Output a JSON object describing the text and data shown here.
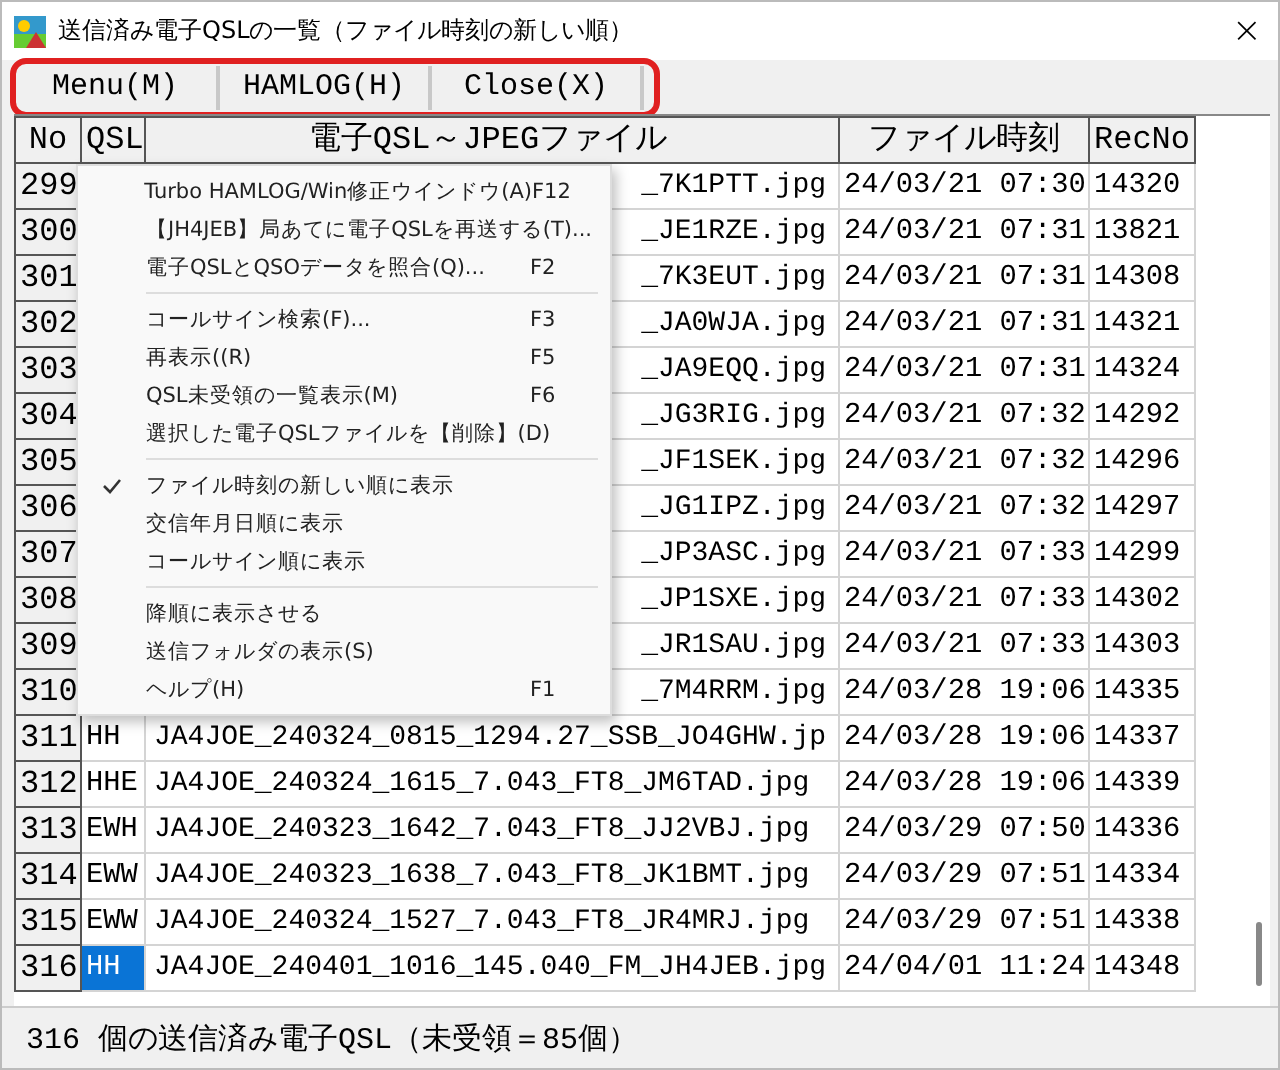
{
  "window": {
    "title": "送信済み電子QSLの一覧（ファイル時刻の新しい順）",
    "close": "×"
  },
  "menu_bar": [
    {
      "label": "Menu(M)"
    },
    {
      "label": "HAMLOG(H)"
    },
    {
      "label": "Close(X)"
    }
  ],
  "table": {
    "columns": [
      "No",
      "QSL",
      "電子QSL～JPEGファイル",
      "ファイル時刻",
      "RecNo"
    ],
    "rows": [
      {
        "no": "299",
        "file": "_7K1PTT.jpg",
        "time": "24/03/21 07:30",
        "recno": "14320"
      },
      {
        "no": "300",
        "file": "_JE1RZE.jpg",
        "time": "24/03/21 07:31",
        "recno": "13821"
      },
      {
        "no": "301",
        "file": "_7K3EUT.jpg",
        "time": "24/03/21 07:31",
        "recno": "14308"
      },
      {
        "no": "302",
        "file": "_JA0WJA.jpg",
        "time": "24/03/21 07:31",
        "recno": "14321"
      },
      {
        "no": "303",
        "file": "_JA9EQQ.jpg",
        "time": "24/03/21 07:31",
        "recno": "14324"
      },
      {
        "no": "304",
        "file": "_JG3RIG.jpg",
        "time": "24/03/21 07:32",
        "recno": "14292"
      },
      {
        "no": "305",
        "file": "_JF1SEK.jpg",
        "time": "24/03/21 07:32",
        "recno": "14296"
      },
      {
        "no": "306",
        "file": "_JG1IPZ.jpg",
        "time": "24/03/21 07:32",
        "recno": "14297"
      },
      {
        "no": "307",
        "file": "_JP3ASC.jpg",
        "time": "24/03/21 07:33",
        "recno": "14299"
      },
      {
        "no": "308",
        "file": "_JP1SXE.jpg",
        "time": "24/03/21 07:33",
        "recno": "14302"
      },
      {
        "no": "309",
        "file": "_JR1SAU.jpg",
        "time": "24/03/21 07:33",
        "recno": "14303"
      },
      {
        "no": "310",
        "file": "_7M4RRM.jpg",
        "time": "24/03/28 19:06",
        "recno": "14335"
      },
      {
        "no": "311",
        "qsl": "HH",
        "file": "JA4JOE_240324_0815_1294.27_SSB_JO4GHW.jp",
        "time": "24/03/28 19:06",
        "recno": "14337",
        "selected": false
      },
      {
        "no": "312",
        "qsl": "HHE",
        "file": "JA4JOE_240324_1615_7.043_FT8_JM6TAD.jpg",
        "time": "24/03/28 19:06",
        "recno": "14339",
        "selected": false
      },
      {
        "no": "313",
        "qsl": "EWH",
        "file": "JA4JOE_240323_1642_7.043_FT8_JJ2VBJ.jpg",
        "time": "24/03/29 07:50",
        "recno": "14336",
        "selected": false
      },
      {
        "no": "314",
        "qsl": "EWW",
        "file": "JA4JOE_240323_1638_7.043_FT8_JK1BMT.jpg",
        "time": "24/03/29 07:51",
        "recno": "14334",
        "selected": false
      },
      {
        "no": "315",
        "qsl": "EWW",
        "file": "JA4JOE_240324_1527_7.043_FT8_JR4MRJ.jpg",
        "time": "24/03/29 07:51",
        "recno": "14338",
        "selected": false
      },
      {
        "no": "316",
        "qsl": "HH",
        "file": "JA4JOE_240401_1016_145.040_FM_JH4JEB.jpg",
        "time": "24/04/01 11:24",
        "recno": "14348",
        "selected": true
      }
    ]
  },
  "context_menu": {
    "items": [
      {
        "kind": "item",
        "label": "Turbo HAMLOG/Win修正ウインドウ(A)",
        "shortcut": "F12",
        "checked": false
      },
      {
        "kind": "item",
        "label": "【JH4JEB】局あてに電子QSLを再送する(T)...",
        "checked": false
      },
      {
        "kind": "item",
        "label": "電子QSLとQSOデータを照合(Q)...",
        "shortcut": "F2",
        "checked": false
      },
      {
        "kind": "separator"
      },
      {
        "kind": "item",
        "label": "コールサイン検索(F)...",
        "shortcut": "F3",
        "checked": false
      },
      {
        "kind": "item",
        "label": "再表示((R)",
        "shortcut": "F5",
        "checked": false
      },
      {
        "kind": "item",
        "label": "QSL未受領の一覧表示(M)",
        "shortcut": "F6",
        "checked": false
      },
      {
        "kind": "item",
        "label": "選択した電子QSLファイルを【削除】(D)",
        "checked": false
      },
      {
        "kind": "separator"
      },
      {
        "kind": "item",
        "label": "ファイル時刻の新しい順に表示",
        "checked": true
      },
      {
        "kind": "item",
        "label": "交信年月日順に表示",
        "checked": false
      },
      {
        "kind": "item",
        "label": "コールサイン順に表示",
        "checked": false
      },
      {
        "kind": "separator"
      },
      {
        "kind": "item",
        "label": "降順に表示させる",
        "checked": false
      },
      {
        "kind": "item",
        "label": "送信フォルダの表示(S)",
        "checked": false
      },
      {
        "kind": "item",
        "label": "ヘルプ(H)",
        "shortcut": "F1",
        "checked": false
      }
    ]
  },
  "status_bar": "316 個の送信済み電子QSL（未受領＝85個）"
}
